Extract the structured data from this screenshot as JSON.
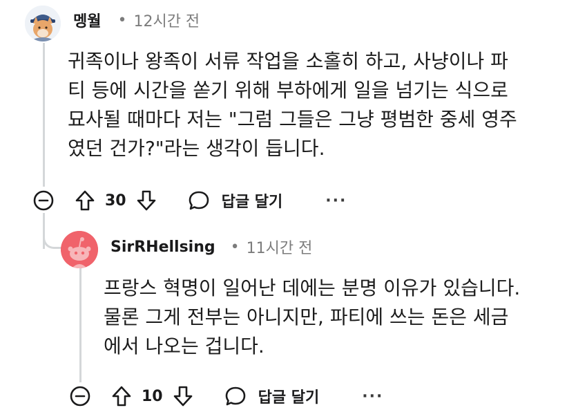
{
  "comments": [
    {
      "author": "멩월",
      "time": "12시간 전",
      "dot": "•",
      "lines": [
        "귀족이나 왕족이 서류 작업을 소홀히 하고, 사냥이나 파",
        "티 등에 시간을 쏟기 위해 부하에게 일을 넘기는 식으로",
        "묘사될 때마다 저는 \"그럼 그들은 그냥 평범한 중세 영주",
        "였던 건가?\"라는 생각이 듭니다."
      ],
      "votes": "30",
      "reply_label": "답글 달기",
      "more": "···",
      "avatar_icon": "fox-character-avatar-icon"
    },
    {
      "author": "SirRHellsing",
      "time": "11시간 전",
      "dot": "•",
      "lines": [
        "프랑스 혁명이 일어난 데에는 분명 이유가 있습니다.",
        "물론 그게 전부는 아니지만, 파티에 쓰는 돈은 세금",
        "에서 나오는 겁니다."
      ],
      "votes": "10",
      "reply_label": "답글 달기",
      "more": "···",
      "avatar_icon": "reddit-snoo-avatar-icon"
    }
  ],
  "colors": {
    "accent_red": "#f0636b",
    "thread_line": "#d4d7d9",
    "meta_gray": "#7c7c7c"
  }
}
